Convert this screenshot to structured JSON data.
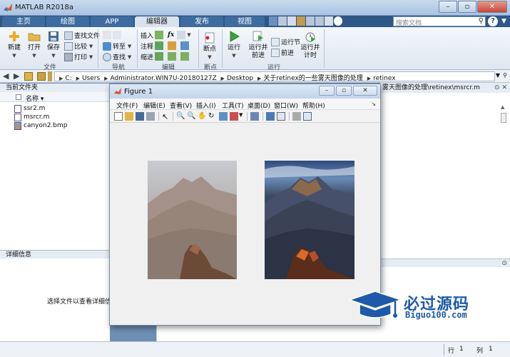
{
  "window": {
    "title": "MATLAB R2018a"
  },
  "tabs": [
    {
      "label": "主页"
    },
    {
      "label": "绘图"
    },
    {
      "label": "APP"
    },
    {
      "label": "编辑器"
    },
    {
      "label": "发布"
    },
    {
      "label": "视图"
    }
  ],
  "search": {
    "placeholder": "搜索文档"
  },
  "ribbon": {
    "new": "新建",
    "open": "打开",
    "save": "保存",
    "find_files": "查找文件",
    "compare": "比较",
    "print": "打印",
    "goto": "转至",
    "find": "查找",
    "insert": "插入",
    "comment": "注释",
    "indent": "缩进",
    "fx": "fx",
    "breakpoints": "断点",
    "run": "运行",
    "run_advance_1": "运行并",
    "run_advance_2": "前进",
    "run_section": "运行节",
    "advance": "前进",
    "run_time_1": "运行并",
    "run_time_2": "计时",
    "groups": {
      "file": "文件",
      "nav": "导航",
      "edit": "编辑",
      "breakpoints": "断点",
      "run": "运行"
    }
  },
  "address": {
    "segments": [
      "C:",
      "Users",
      "Administrator.WIN7U-20180127Z",
      "Desktop",
      "关于retinex的一些雾天图像的处理",
      "retinex"
    ]
  },
  "current_folder": {
    "title": "当前文件夹",
    "column": "名称",
    "files": [
      "ssr2.m",
      "msrcr.m",
      "canyon2.bmp"
    ]
  },
  "details": {
    "title": "详细信息",
    "message": "选择文件以查看详细信息"
  },
  "editor_path": "雾天图像的处理\\retinex\\msrcr.m",
  "figure": {
    "title": "Figure 1",
    "menus": [
      "文件(F)",
      "编辑(E)",
      "查看(V)",
      "插入(I)",
      "工具(T)",
      "桌面(D)",
      "窗口(W)",
      "帮助(H)"
    ]
  },
  "status": {
    "row_label": "行",
    "row": "1",
    "col_label": "列",
    "col": "1"
  },
  "watermark": {
    "text": "必过源码",
    "sub": "Biguo100.com"
  },
  "colors": {
    "ribbon_tab_bg": "#2d5787",
    "accent": "#1e5aa8"
  }
}
